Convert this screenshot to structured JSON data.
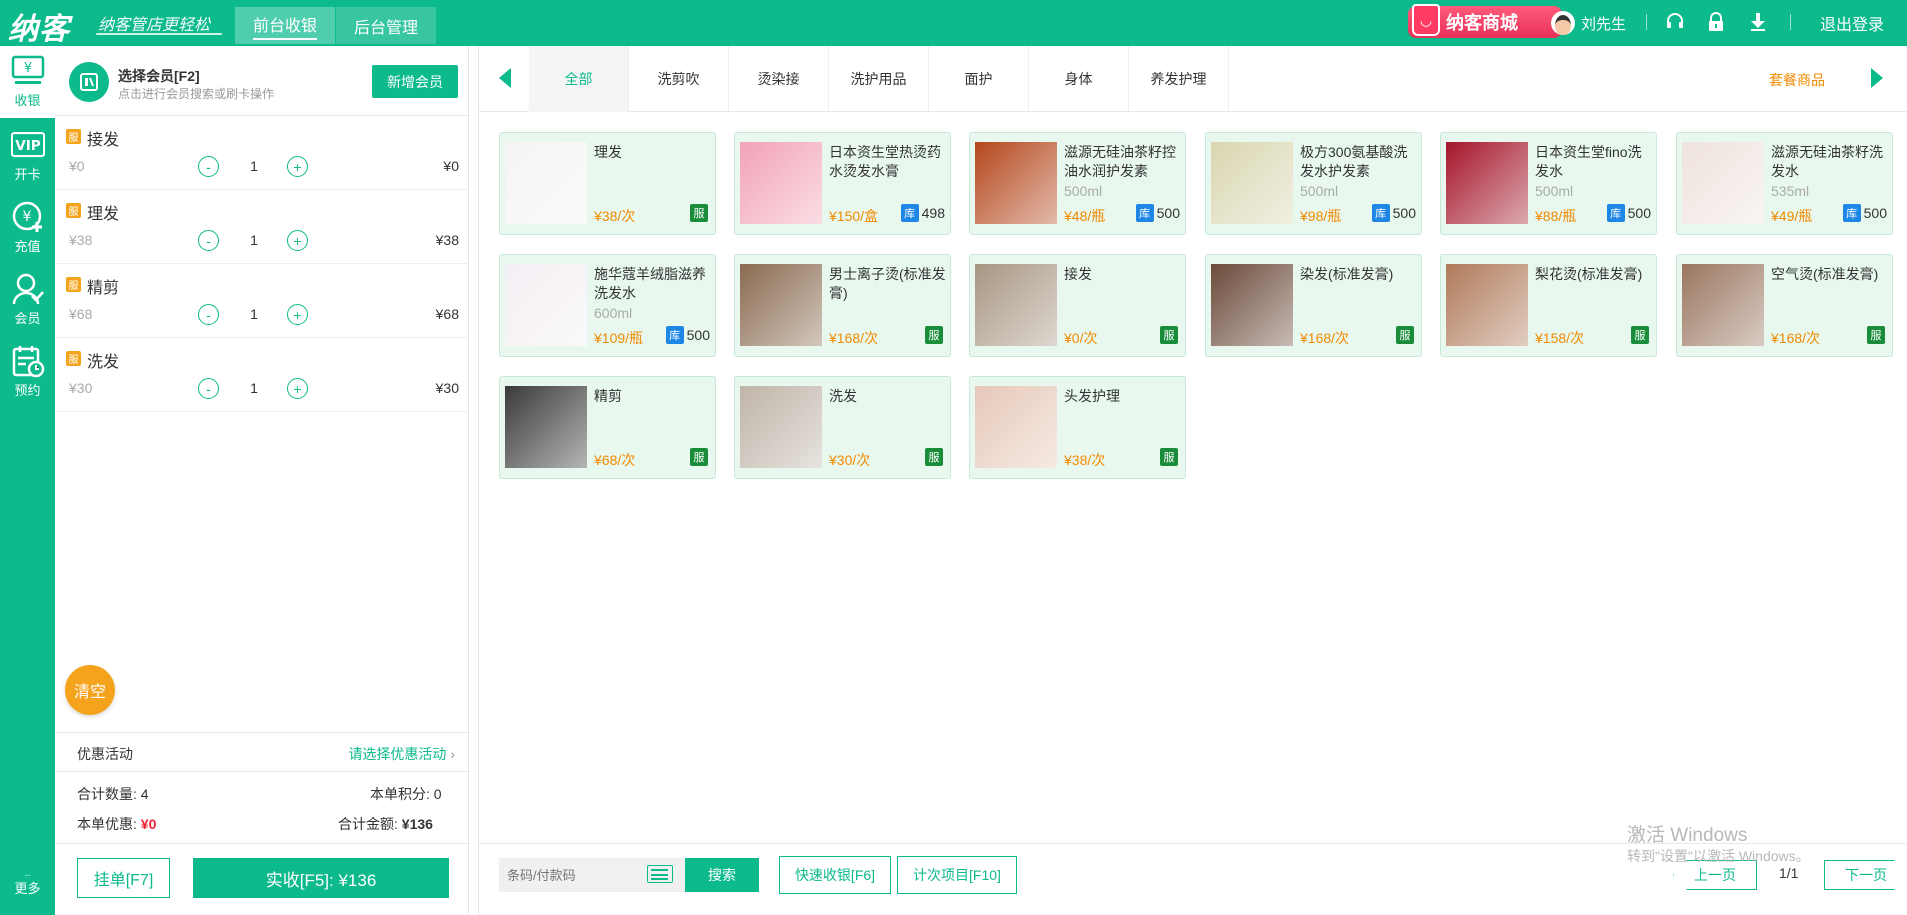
{
  "header": {
    "logo": "纳客",
    "slogan": "纳客管店更轻松",
    "tabs": [
      {
        "label": "前台收银",
        "active": true
      },
      {
        "label": "后台管理",
        "active": false
      }
    ],
    "mall": "纳客商城",
    "user": "刘先生",
    "logout": "退出登录",
    "icons": [
      "headset-icon",
      "lock-icon",
      "download-icon"
    ]
  },
  "sidenav": {
    "items": [
      {
        "label": "收银",
        "icon": "cashier-icon",
        "active": true
      },
      {
        "label": "开卡",
        "icon": "vip-card-icon",
        "active": false
      },
      {
        "label": "充值",
        "icon": "recharge-icon",
        "active": false
      },
      {
        "label": "会员",
        "icon": "member-icon",
        "active": false
      },
      {
        "label": "预约",
        "icon": "appointment-icon",
        "active": false
      }
    ],
    "more": "更多"
  },
  "member": {
    "title": "选择会员[F2]",
    "subtitle": "点击进行会员搜索或刷卡操作",
    "add_button": "新增会员"
  },
  "cart": {
    "badge": "服",
    "items": [
      {
        "name": "接发",
        "unit_price": "¥0",
        "qty": "1",
        "total": "¥0"
      },
      {
        "name": "理发",
        "unit_price": "¥38",
        "qty": "1",
        "total": "¥38"
      },
      {
        "name": "精剪",
        "unit_price": "¥68",
        "qty": "1",
        "total": "¥68"
      },
      {
        "name": "洗发",
        "unit_price": "¥30",
        "qty": "1",
        "total": "¥30"
      }
    ],
    "clear": "清空",
    "promo_label": "优惠活动",
    "promo_link": "请选择优惠活动",
    "count_label": "合计数量:",
    "count_value": "4",
    "points_label": "本单积分:",
    "points_value": "0",
    "discount_label": "本单优惠:",
    "discount_value": "¥0",
    "amount_label": "合计金额:",
    "amount_value": "¥136",
    "hang_button": "挂单[F7]",
    "pay_button": "实收[F5]: ¥136"
  },
  "categories": {
    "tabs": [
      "全部",
      "洗剪吹",
      "烫染接",
      "洗护用品",
      "面护",
      "身体",
      "养发护理"
    ],
    "active_index": 0,
    "package": "套餐商品"
  },
  "products": [
    {
      "name": "理发",
      "spec": "",
      "price": "¥38/次",
      "type": "service",
      "tag": "服",
      "stock": "",
      "thumb": "#f4f4f4"
    },
    {
      "name": "日本资生堂热烫药水烫发水膏",
      "spec": "",
      "price": "¥150/盒",
      "type": "goods",
      "tag": "库",
      "stock": "498",
      "thumb": "#f2a3b8"
    },
    {
      "name": "滋源无硅油茶籽控油水润护发素",
      "spec": "500ml",
      "price": "¥48/瓶",
      "type": "goods",
      "tag": "库",
      "stock": "500",
      "thumb": "#b4471c"
    },
    {
      "name": "极方300氨基酸洗发水护发素",
      "spec": "500ml",
      "price": "¥98/瓶",
      "type": "goods",
      "tag": "库",
      "stock": "500",
      "thumb": "#d9d6b0"
    },
    {
      "name": "日本资生堂fino洗发水",
      "spec": "500ml",
      "price": "¥88/瓶",
      "type": "goods",
      "tag": "库",
      "stock": "500",
      "thumb": "#a4162a"
    },
    {
      "name": "滋源无硅油茶籽洗发水",
      "spec": "535ml",
      "price": "¥49/瓶",
      "type": "goods",
      "tag": "库",
      "stock": "500",
      "thumb": "#efe3de"
    },
    {
      "name": "施华蔻羊绒脂滋养洗发水",
      "spec": "600ml",
      "price": "¥109/瓶",
      "type": "goods",
      "tag": "库",
      "stock": "500",
      "thumb": "#f3eef3"
    },
    {
      "name": "男士离子烫(标准发膏)",
      "spec": "",
      "price": "¥168/次",
      "type": "service",
      "tag": "服",
      "stock": "",
      "thumb": "#8a6a50"
    },
    {
      "name": "接发",
      "spec": "",
      "price": "¥0/次",
      "type": "service",
      "tag": "服",
      "stock": "",
      "thumb": "#a79682"
    },
    {
      "name": "染发(标准发膏)",
      "spec": "",
      "price": "¥168/次",
      "type": "service",
      "tag": "服",
      "stock": "",
      "thumb": "#6b4a3a"
    },
    {
      "name": "梨花烫(标准发膏)",
      "spec": "",
      "price": "¥158/次",
      "type": "service",
      "tag": "服",
      "stock": "",
      "thumb": "#b07a5a"
    },
    {
      "name": "空气烫(标准发膏)",
      "spec": "",
      "price": "¥168/次",
      "type": "service",
      "tag": "服",
      "stock": "",
      "thumb": "#9a7660"
    },
    {
      "name": "精剪",
      "spec": "",
      "price": "¥68/次",
      "type": "service",
      "tag": "服",
      "stock": "",
      "thumb": "#3a3a3a"
    },
    {
      "name": "洗发",
      "spec": "",
      "price": "¥30/次",
      "type": "service",
      "tag": "服",
      "stock": "",
      "thumb": "#bfb4a8"
    },
    {
      "name": "头发护理",
      "spec": "",
      "price": "¥38/次",
      "type": "service",
      "tag": "服",
      "stock": "",
      "thumb": "#e6c8b8"
    }
  ],
  "footer": {
    "barcode_placeholder": "条码/付款码",
    "search_button": "搜索",
    "quick_checkout": "快速收银[F6]",
    "count_items": "计次项目[F10]",
    "watermark_title": "激活 Windows",
    "watermark_sub": "转到\"设置\"以激活 Windows。",
    "prev_page": "上一页",
    "page_indicator": "1/1",
    "next_page": "下一页"
  },
  "colors": {
    "primary": "#0cba8c",
    "price": "#f08a00",
    "service_tag": "#1a8d3a",
    "stock_tag": "#1e87e6",
    "badge": "#f3a41a",
    "clear": "#f5a31c"
  }
}
